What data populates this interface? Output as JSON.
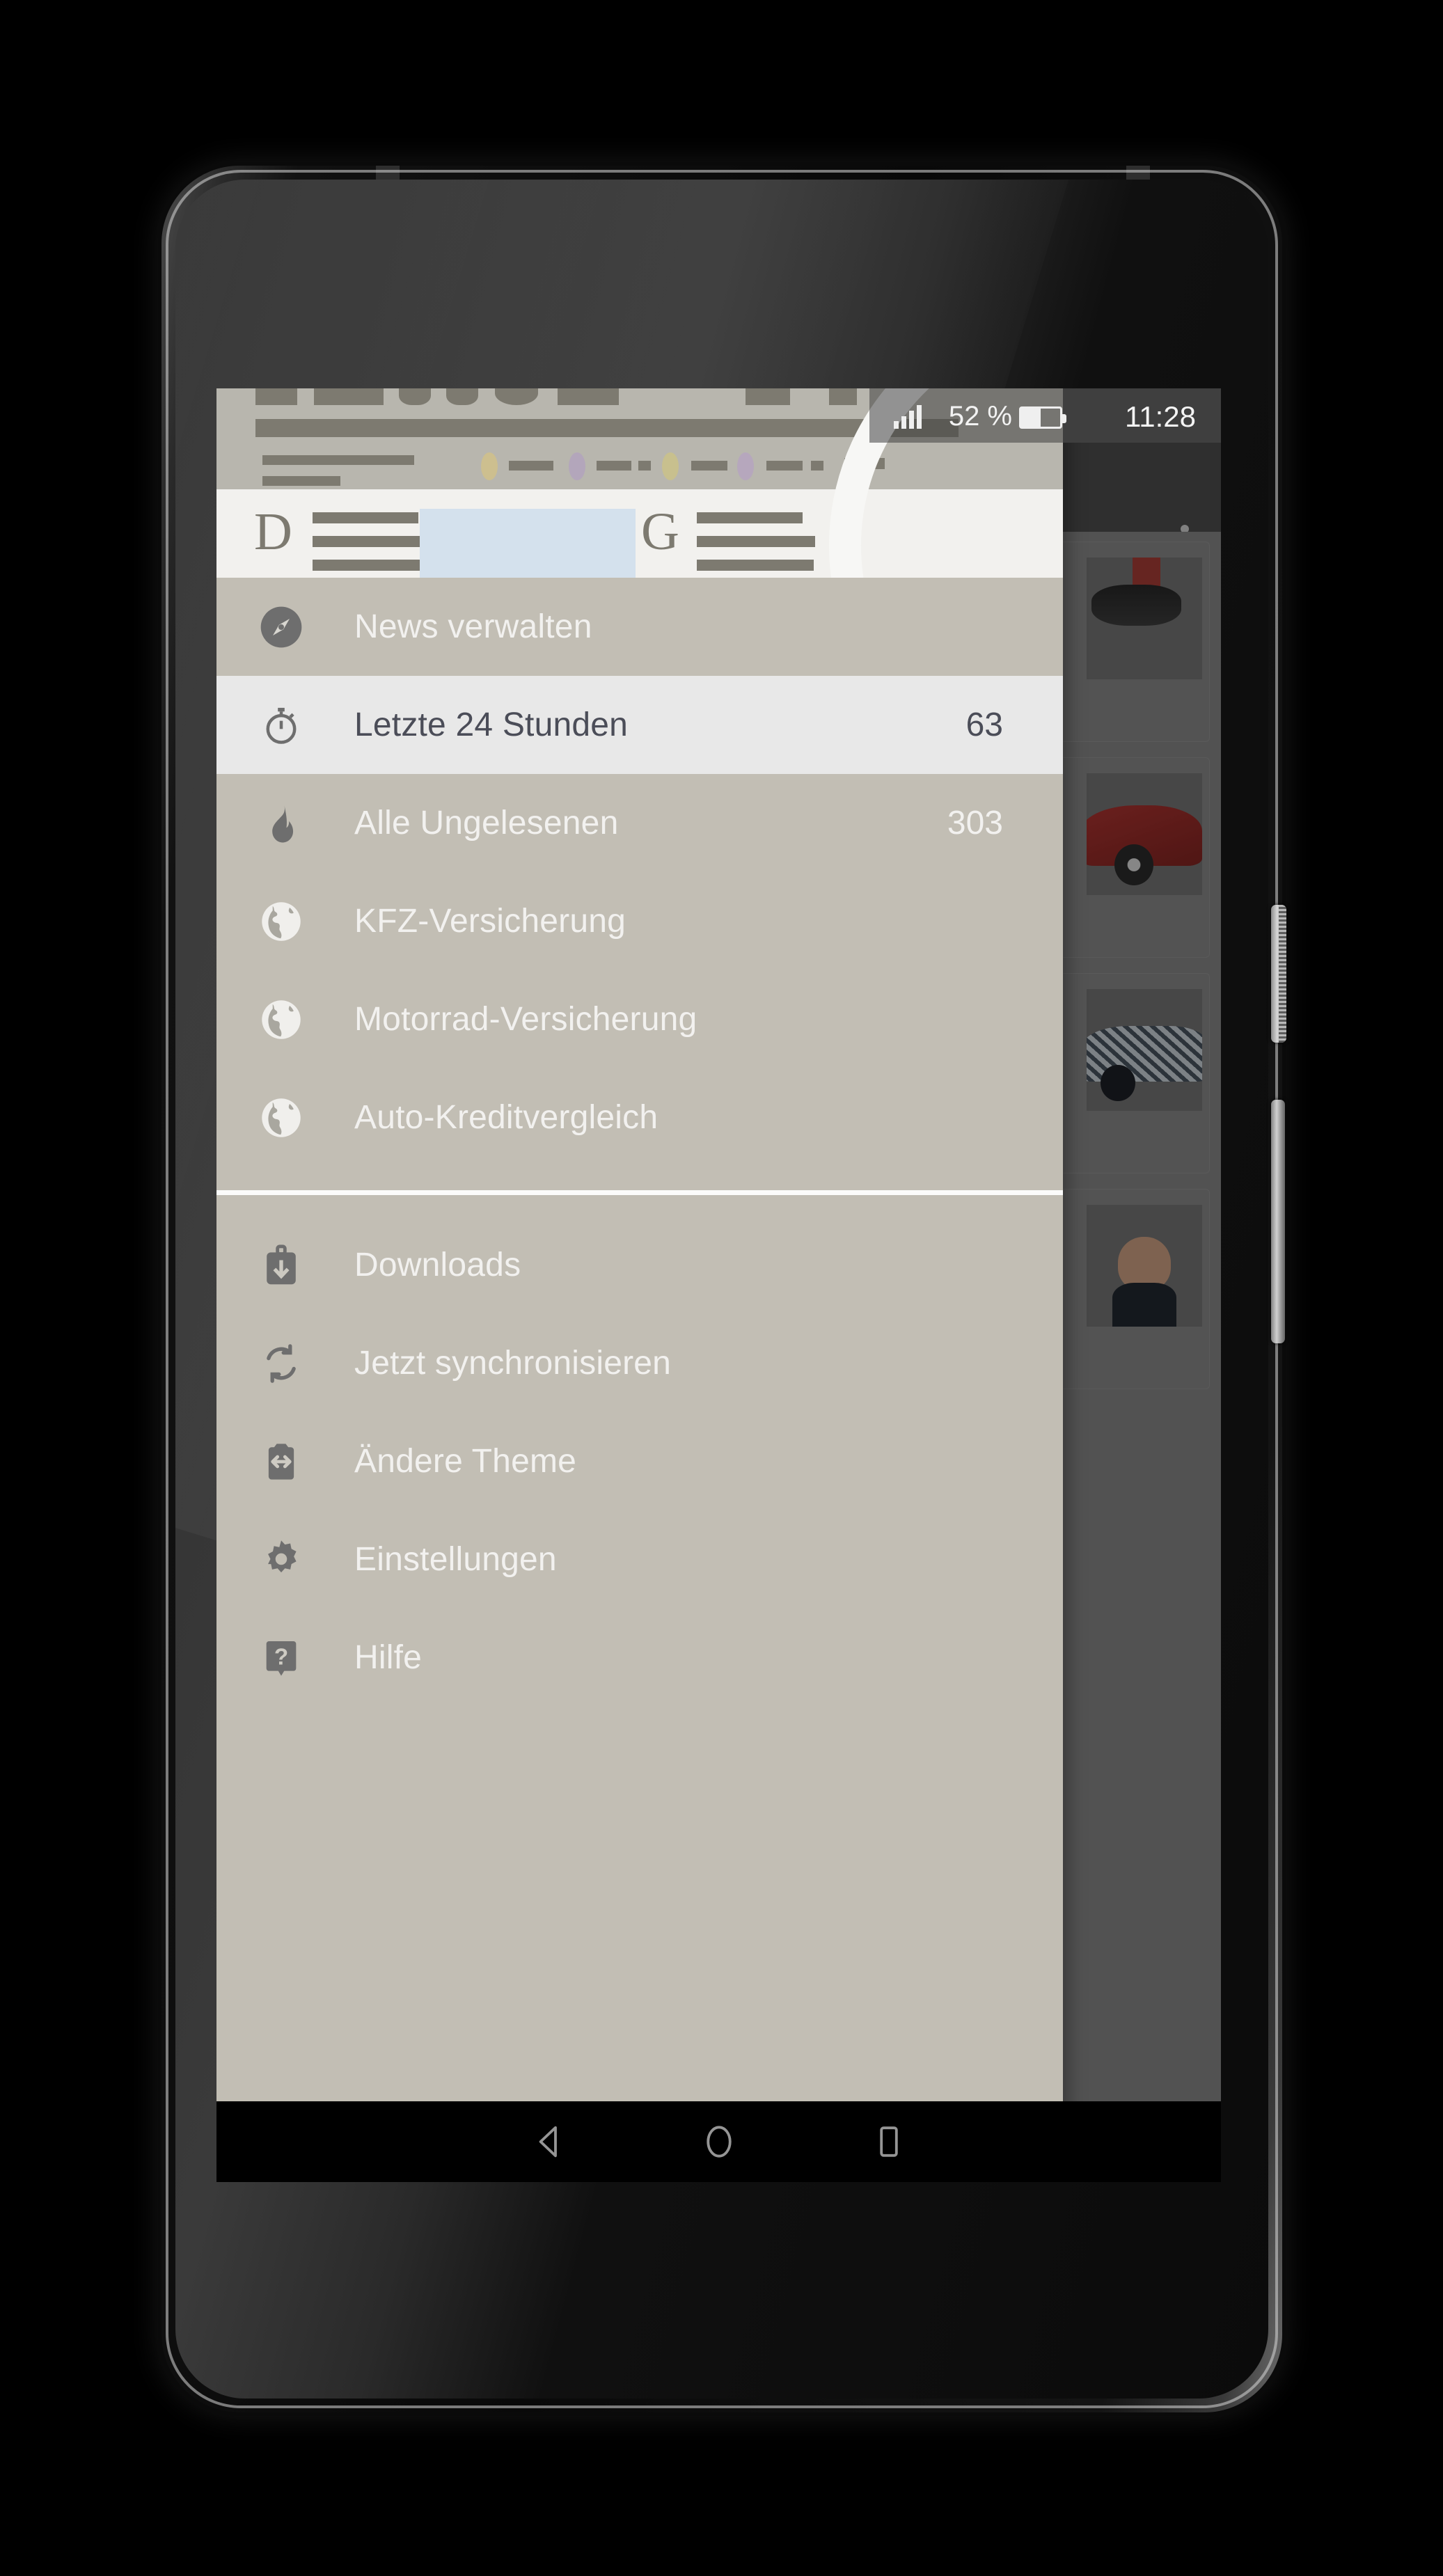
{
  "device": {
    "type": "android-smartphone",
    "frame_color": "#111111"
  },
  "status_bar": {
    "signal_icon": "signal-bars-icon",
    "battery_percent_label": "52 %",
    "battery_level": 52,
    "battery_icon": "battery-icon",
    "clock": "11:28"
  },
  "app_bar": {
    "overflow_icon": "overflow-menu-icon"
  },
  "drawer": {
    "header": {
      "graphic": "newspaper-illustration",
      "masthead_letter_left": "D",
      "masthead_letter_right": "G"
    },
    "primary_items": [
      {
        "icon": "compass-icon",
        "label": "News verwalten",
        "count": "",
        "selected": false
      },
      {
        "icon": "stopwatch-icon",
        "label": "Letzte 24 Stunden",
        "count": "63",
        "selected": true
      },
      {
        "icon": "flame-icon",
        "label": "Alle Ungelesenen",
        "count": "303",
        "selected": false
      },
      {
        "icon": "globe-icon",
        "label": "KFZ-Versicherung",
        "count": "",
        "selected": false
      },
      {
        "icon": "globe-icon",
        "label": "Motorrad-Versicherung",
        "count": "",
        "selected": false
      },
      {
        "icon": "globe-icon",
        "label": "Auto-Kreditvergleich",
        "count": "",
        "selected": false
      }
    ],
    "secondary_items": [
      {
        "icon": "download-bag-icon",
        "label": "Downloads",
        "count": "",
        "selected": false
      },
      {
        "icon": "sync-icon",
        "label": "Jetzt synchronisieren",
        "count": "",
        "selected": false
      },
      {
        "icon": "theme-swap-icon",
        "label": "Ändere Theme",
        "count": "",
        "selected": false
      },
      {
        "icon": "gear-icon",
        "label": "Einstellungen",
        "count": "",
        "selected": false
      },
      {
        "icon": "help-icon",
        "label": "Hilfe",
        "count": "",
        "selected": false
      }
    ]
  },
  "content_cards": [
    {
      "thumb": "snow-tire-photo"
    },
    {
      "thumb": "red-car-photo"
    },
    {
      "thumb": "camouflaged-car-photo"
    },
    {
      "thumb": "man-portrait-photo"
    }
  ],
  "nav_bar": {
    "back_icon": "back-triangle-icon",
    "home_icon": "home-circle-icon",
    "recents_icon": "recents-square-icon"
  },
  "colors": {
    "drawer_bg": "#c2beb4",
    "selected_row_bg": "#e8e8e8",
    "selected_row_text": "#4b4d58",
    "row_text": "#f2f1ef",
    "icon_gray": "#6e6e6e",
    "divider": "#fbfbfa",
    "status_bar_bg": "#3f3f3f",
    "nav_bar_bg": "#000000"
  }
}
